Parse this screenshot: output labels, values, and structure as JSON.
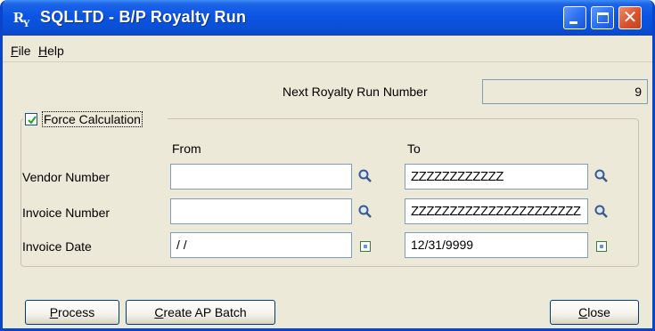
{
  "window": {
    "title": "SQLLTD - B/P Royalty Run",
    "icon_letters": "R",
    "icon_sub": "Y"
  },
  "menu": {
    "file_first": "F",
    "file_rest": "ile",
    "help_first": "H",
    "help_rest": "elp"
  },
  "header": {
    "run_number_label": "Next Royalty Run Number",
    "run_number_value": "9"
  },
  "options": {
    "force_calculation_label": "Force Calculation",
    "force_calculation_checked": true
  },
  "columns": {
    "from": "From",
    "to": "To"
  },
  "rows": [
    {
      "label": "Vendor Number",
      "from_value": "",
      "to_value": "ZZZZZZZZZZZZ"
    },
    {
      "label": "Invoice Number",
      "from_value": "",
      "to_value": "ZZZZZZZZZZZZZZZZZZZZZZ"
    },
    {
      "label": "Invoice Date",
      "from_value": "/ /",
      "to_value": "12/31/9999"
    }
  ],
  "buttons": {
    "process_first": "P",
    "process_rest": "rocess",
    "create_first": "C",
    "create_rest": "reate AP Batch",
    "close_first": "C",
    "close_rest": "lose"
  },
  "colors": {
    "titlebar": "#0b55e4",
    "window_bg": "#ece9d8",
    "field_border": "#7f9db9",
    "close_button": "#d8522e"
  },
  "icons": {
    "lookup": "magnifier-icon",
    "calendar": "calendar-icon",
    "check": "checkmark-icon"
  }
}
